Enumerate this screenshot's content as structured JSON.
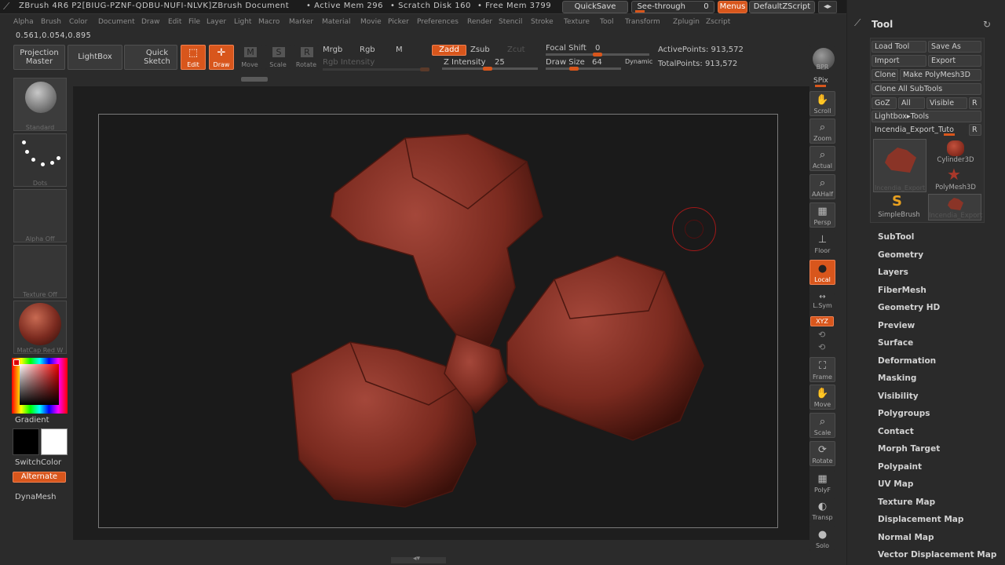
{
  "titlebar": {
    "app": "ZBrush 4R6 P2[BIUG-PZNF-QDBU-NUFI-NLVK]",
    "document": "ZBrush Document",
    "active_mem": "• Active Mem 296",
    "scratch": "• Scratch Disk 160",
    "free_mem": "• Free Mem 3799",
    "quicksave": "QuickSave",
    "seethrough": "See-through",
    "seethrough_val": "0",
    "menus": "Menus",
    "script": "DefaultZScript"
  },
  "menubar": [
    "Alpha",
    "Brush",
    "Color",
    "Document",
    "Draw",
    "Edit",
    "File",
    "Layer",
    "Light",
    "Macro",
    "Marker",
    "Material",
    "Movie",
    "Picker",
    "Preferences",
    "Render",
    "Stencil",
    "Stroke",
    "Texture",
    "Tool",
    "Transform",
    "Zplugin",
    "Zscript"
  ],
  "coords": "0.561,0.054,0.895",
  "shelf": {
    "projection": "Projection",
    "master": "Master",
    "lightbox": "LightBox",
    "quick": "Quick",
    "sketch": "Sketch",
    "edit": "Edit",
    "draw": "Draw",
    "move": "Move",
    "scale": "Scale",
    "rotate": "Rotate",
    "mrgb": "Mrgb",
    "rgb": "Rgb",
    "m": "M",
    "rgb_intensity": "Rgb Intensity",
    "zadd": "Zadd",
    "zsub": "Zsub",
    "zcut": "Zcut",
    "z_intensity": "Z Intensity",
    "z_intensity_val": "25",
    "focal_shift": "Focal Shift",
    "focal_shift_val": "0",
    "draw_size": "Draw Size",
    "draw_size_val": "64",
    "dynamic": "Dynamic",
    "active_points": "ActivePoints: 913,572",
    "total_points": "TotalPoints: 913,572"
  },
  "left": {
    "brush": "Standard",
    "stroke": "Dots",
    "alpha": "Alpha Off",
    "texture": "Texture Off",
    "material": "MatCap Red W",
    "gradient": "Gradient",
    "switchcolor": "SwitchColor",
    "alternate": "Alternate",
    "dynamesh": "DynaMesh"
  },
  "rightshelf": {
    "bpr": "BPR",
    "spix": "SPix",
    "scroll": "Scroll",
    "zoom": "Zoom",
    "actual": "Actual",
    "aahalf": "AAHalf",
    "persp": "Persp",
    "floor": "Floor",
    "local": "Local",
    "lsym": "L.Sym",
    "xyz": "XYZ",
    "frame": "Frame",
    "move": "Move",
    "scale": "Scale",
    "rotate": "Rotate",
    "polyf": "PolyF",
    "transp": "Transp",
    "solo": "Solo"
  },
  "tool": {
    "title": "Tool",
    "load": "Load Tool",
    "saveas": "Save As",
    "import": "Import",
    "export": "Export",
    "clone": "Clone",
    "makepoly": "Make PolyMesh3D",
    "cloneall": "Clone All SubTools",
    "goz": "GoZ",
    "all": "All",
    "visible": "Visible",
    "r": "R",
    "lightbox_tools": "Lightbox▸Tools",
    "incendia": "Incendia_Export_Tuto",
    "thumbs": [
      "Incendia_Export",
      "Cylinder3D",
      "PolyMesh3D",
      "SimpleBrush",
      "Incendia_Export"
    ],
    "menus": [
      "SubTool",
      "Geometry",
      "Layers",
      "FiberMesh",
      "Geometry HD",
      "Preview",
      "Surface",
      "Deformation",
      "Masking",
      "Visibility",
      "Polygroups",
      "Contact",
      "Morph Target",
      "Polypaint",
      "UV Map",
      "Texture Map",
      "Displacement Map",
      "Normal Map",
      "Vector Displacement Map"
    ]
  },
  "colors": {
    "accent": "#d8561c",
    "model": "#7a2a1f"
  }
}
